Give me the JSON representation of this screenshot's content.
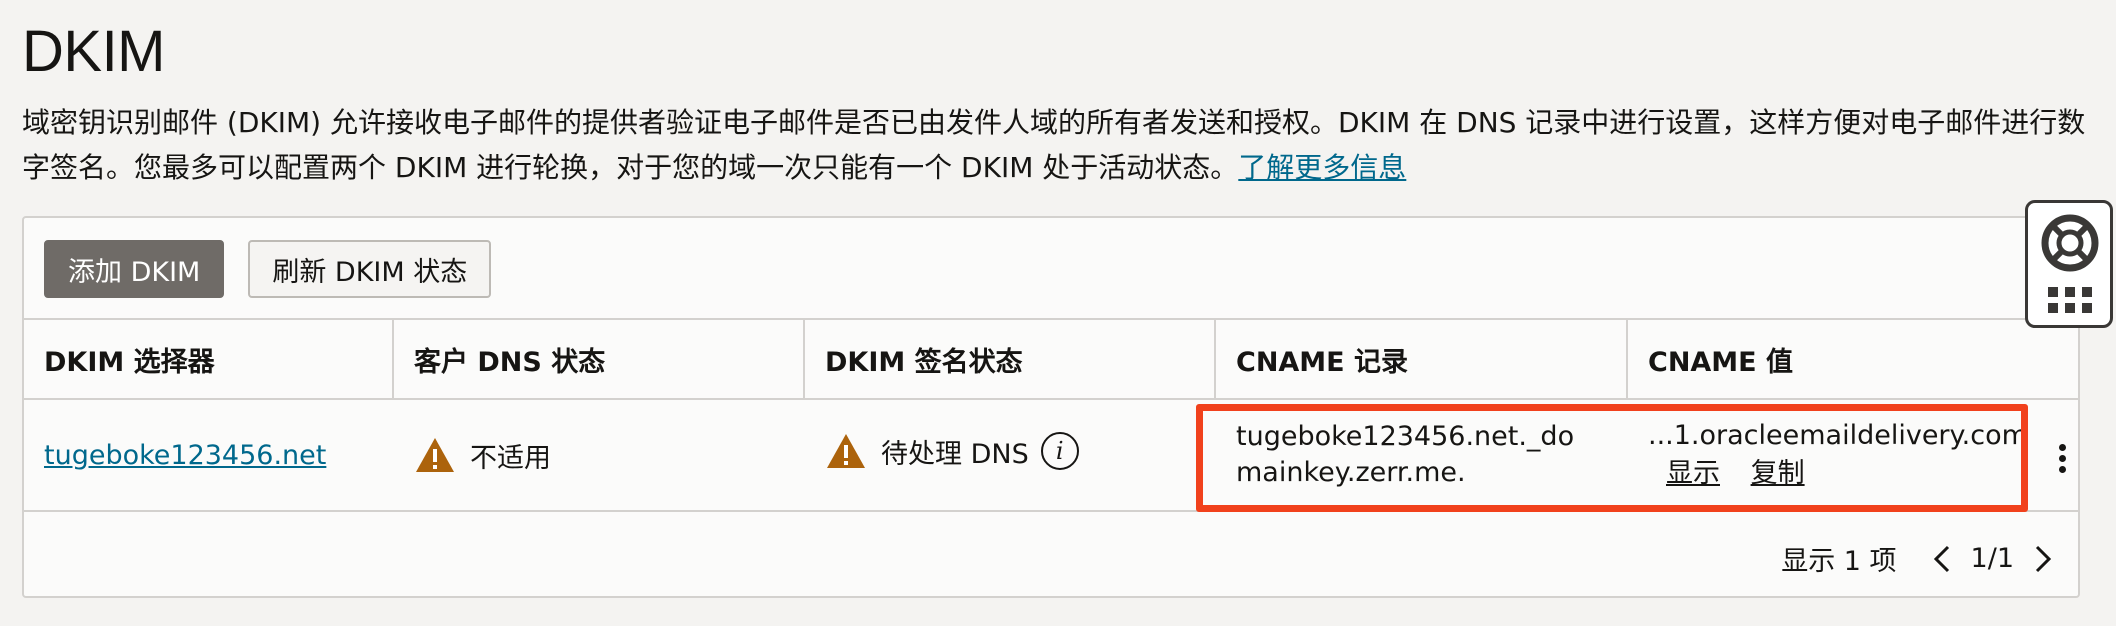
{
  "page": {
    "title": "DKIM",
    "description": "域密钥识别邮件 (DKIM) 允许接收电子邮件的提供者验证电子邮件是否已由发件人域的所有者发送和授权。DKIM 在 DNS 记录中进行设置，这样方便对电子邮件进行数字签名。您最多可以配置两个 DKIM 进行轮换，对于您的域一次只能有一个 DKIM 处于活动状态。",
    "learn_more": "了解更多信息"
  },
  "toolbar": {
    "add_label": "添加 DKIM",
    "refresh_label": "刷新 DKIM 状态"
  },
  "table": {
    "headers": [
      "DKIM 选择器",
      "客户 DNS 状态",
      "DKIM 签名状态",
      "CNAME 记录",
      "CNAME 值"
    ],
    "rows": [
      {
        "selector": "tugeboke123456.net",
        "dns_status": "不适用",
        "sign_status": "待处理 DNS",
        "cname_record": "tugeboke123456.net._domainkey.zerr.me.",
        "cname_value": "...1.oracleemaildelivery.com",
        "show_label": "显示",
        "copy_label": "复制"
      }
    ]
  },
  "pagination": {
    "summary": "显示 1 项",
    "page": "1/1"
  },
  "colors": {
    "warning": "#ac630c",
    "highlight": "#f1411c",
    "link": "#00688c",
    "primary_button": "#6f6b67"
  },
  "icons": [
    "warning-icon",
    "info-icon",
    "kebab-menu-icon",
    "chevron-left-icon",
    "chevron-right-icon",
    "lifebuoy-icon",
    "apps-grid-icon"
  ]
}
